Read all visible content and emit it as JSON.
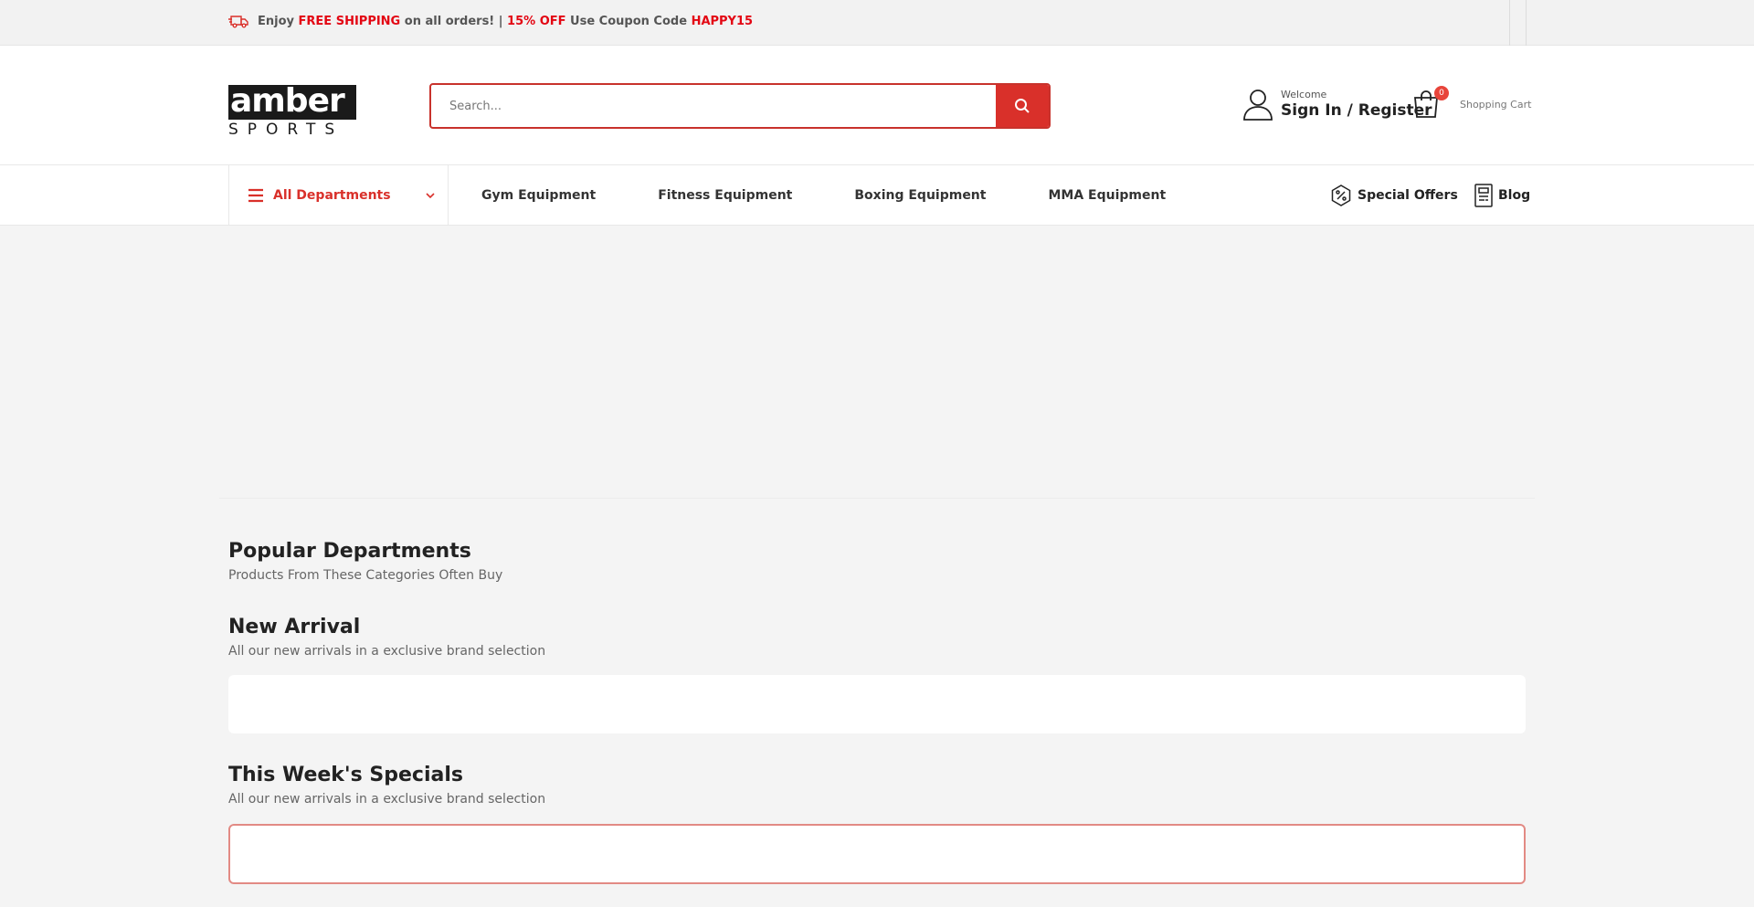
{
  "topbar": {
    "promo": {
      "enjoy": "Enjoy",
      "free_shipping": "FREE SHIPPING",
      "on_all_orders": "on all orders! |",
      "discount": "15% OFF",
      "use_code": "Use Coupon Code",
      "code": "HAPPY15"
    }
  },
  "header": {
    "logo_top": "amber",
    "logo_bottom": "SPORTS",
    "search_placeholder": "Search...",
    "account": {
      "welcome": "Welcome",
      "signin": "Sign In / Register"
    },
    "cart": {
      "count": "0",
      "label": "Shopping Cart"
    }
  },
  "nav": {
    "departments": "All Departments",
    "items": [
      "Gym Equipment",
      "Fitness Equipment",
      "Boxing Equipment",
      "MMA Equipment"
    ],
    "special_offers": "Special Offers",
    "blog": "Blog"
  },
  "sections": {
    "popular": {
      "title": "Popular Departments",
      "subtitle": "Products From These Categories Often Buy"
    },
    "new_arrival": {
      "title": "New Arrival",
      "subtitle": "All our new arrivals in a exclusive brand selection"
    },
    "specials": {
      "title": "This Week's Specials",
      "subtitle": "All our new arrivals in a exclusive brand selection"
    }
  },
  "colors": {
    "accent": "#d9302a",
    "promo_red": "#e30613"
  }
}
